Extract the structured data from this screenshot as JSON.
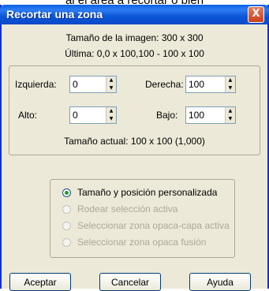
{
  "background_text": "al el área a recortar o bien",
  "window": {
    "title": "Recortar una zona",
    "close_label": "X"
  },
  "info": {
    "image_size": "Tamaño de la imagen: 300 x 300",
    "last": "Última: 0,0 x 100,100  - 100 x 100"
  },
  "fields": {
    "left": {
      "label": "Izquierda:",
      "value": "0"
    },
    "right": {
      "label": "Derecha:",
      "value": "100"
    },
    "top": {
      "label": "Alto:",
      "value": "0"
    },
    "bottom": {
      "label": "Bajo:",
      "value": "100"
    },
    "current_size": "Tamaño actual: 100 x 100 (1,000)"
  },
  "options": [
    {
      "label": "Tamaño y posición personalizada",
      "selected": true,
      "enabled": true
    },
    {
      "label": "Rodear selección activa",
      "selected": false,
      "enabled": false
    },
    {
      "label": "Seleccionar zona opaca-capa activa",
      "selected": false,
      "enabled": false
    },
    {
      "label": "Seleccionar zona opaca fusión",
      "selected": false,
      "enabled": false
    }
  ],
  "buttons": {
    "ok": "Aceptar",
    "cancel": "Cancelar",
    "help": "Ayuda"
  }
}
